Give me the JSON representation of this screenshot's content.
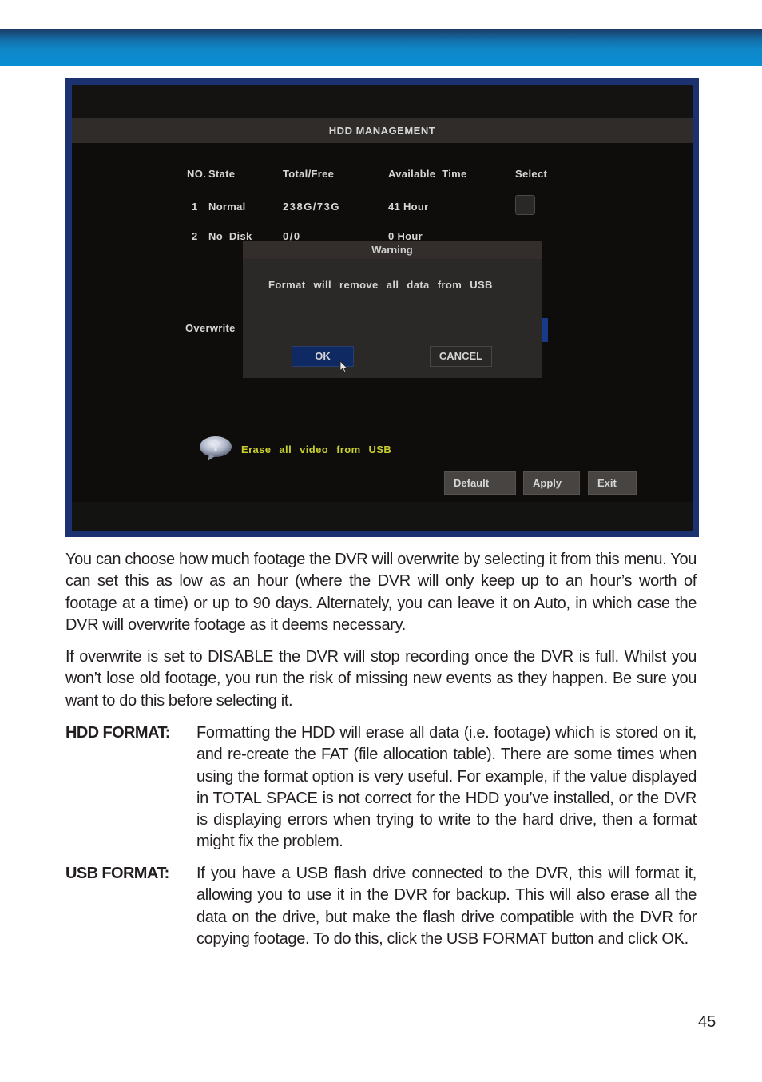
{
  "screenshot": {
    "title": "HDD  MANAGEMENT",
    "columns": [
      "NO.",
      "State",
      "Total/Free",
      "Available  Time",
      "Select"
    ],
    "rows": [
      {
        "no": "1",
        "state": "Normal",
        "total_free": "238G/73G",
        "available_time": "41 Hour",
        "selected": false
      },
      {
        "no": "2",
        "state": "No  Disk",
        "total_free": "0/0",
        "available_time": "0 Hour"
      }
    ],
    "overwrite_label": "Overwrite",
    "dialog": {
      "title": "Warning",
      "message": "Format will remove all data from USB",
      "ok_label": "OK",
      "cancel_label": "CANCEL"
    },
    "tip": {
      "icon": "info-bubble-icon",
      "text": "Erase all video from USB"
    },
    "buttons": {
      "default": "Default",
      "apply": "Apply",
      "exit": "Exit"
    },
    "colors": {
      "frame": "#1c3270",
      "tip_text": "#c8d030",
      "ok_button": "#0f2a63"
    }
  },
  "body": {
    "paragraph_1": "You can choose how much footage the DVR will overwrite by selecting it from this menu. You can set this as low as an hour (where the DVR will only keep up to an hour’s worth of footage at a time) or up to 90 days. Alternately, you can leave it on Auto, in which case the DVR will overwrite footage as it deems necessary.",
    "paragraph_2": "If overwrite is set to DISABLE the DVR will stop recording once the DVR is full. Whilst you won’t lose old footage, you run the risk of missing new events as they happen. Be sure you want to do this before selecting it.",
    "definitions": [
      {
        "term": "HDD FORMAT:",
        "text": "Formatting the HDD will erase all data (i.e. footage) which is stored on it, and re-create the FAT (file allocation table). There are some times when using the format option is very useful. For example, if the value displayed in TOTAL SPACE is not correct for the HDD you’ve installed, or the DVR is displaying errors when trying to write to the hard drive, then a format might fix the problem."
      },
      {
        "term": "USB FORMAT:",
        "text": "If you have a USB flash drive connected to the DVR, this will format it, allowing you to use it in the DVR for backup. This will also erase all the data on the drive, but make the flash drive compatible with the DVR for copying footage. To do this, click the USB FORMAT button and click OK."
      }
    ]
  },
  "page_number": "45",
  "header_band_color": "#0a8fd4"
}
